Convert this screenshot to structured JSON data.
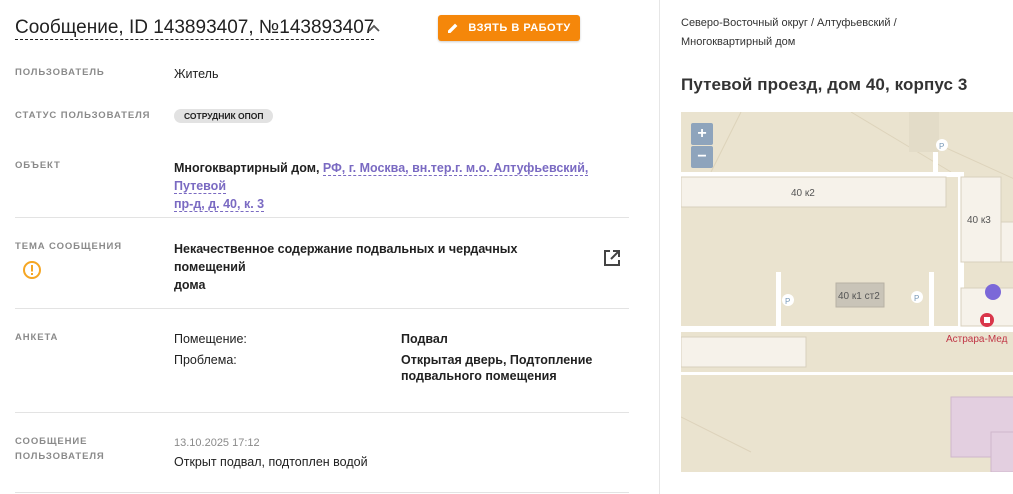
{
  "header": {
    "title": "Сообщение, ID 143893407, №143893407",
    "take_button": "ВЗЯТЬ В РАБОТУ"
  },
  "fields": {
    "user": {
      "label": "ПОЛЬЗОВАТЕЛЬ",
      "value": "Житель"
    },
    "user_status": {
      "label": "СТАТУС ПОЛЬЗОВАТЕЛЯ",
      "badge": "СОТРУДНИК ОПОП"
    },
    "object": {
      "label": "ОБЪЕКТ",
      "prefix": "Многоквартирный дом, ",
      "link_line1": "РФ, г. Москва, вн.тер.г. м.о. Алтуфьевский, Путевой",
      "link_line2": "пр-д, д. 40, к. 3"
    },
    "topic": {
      "label": "ТЕМА СООБЩЕНИЯ",
      "line1": "Некачественное содержание подвальных и чердачных помещений",
      "line2": "дома"
    },
    "survey": {
      "label": "АНКЕТА",
      "rows": [
        {
          "key": "Помещение:",
          "value_line1": "Подвал",
          "value_line2": ""
        },
        {
          "key": "Проблема:",
          "value_line1": "Открытая дверь, Подтопление",
          "value_line2": "подвального помещения"
        }
      ]
    },
    "user_message": {
      "label_line1": "СООБЩЕНИЕ",
      "label_line2": "ПОЛЬЗОВАТЕЛЯ",
      "date": "13.10.2025 17:12",
      "text": "Открыт подвал, подтоплен водой"
    }
  },
  "sidebar": {
    "breadcrumb_line1": "Северо-Восточный округ / Алтуфьевский /",
    "breadcrumb_line2": "Многоквартирный дом",
    "address": "Путевой проезд, дом 40, корпус 3"
  },
  "map": {
    "zoom_in": "+",
    "zoom_out": "−",
    "buildings": [
      "40 к2",
      "40 к3",
      "40 к1 ст2"
    ],
    "poi": "Астрара-Мед",
    "parking": "P"
  },
  "colors": {
    "accent": "#f5870a",
    "link": "#7a6ac2",
    "warning": "#f5a623",
    "marker": "#7b68d8",
    "poi": "#d9364a"
  }
}
